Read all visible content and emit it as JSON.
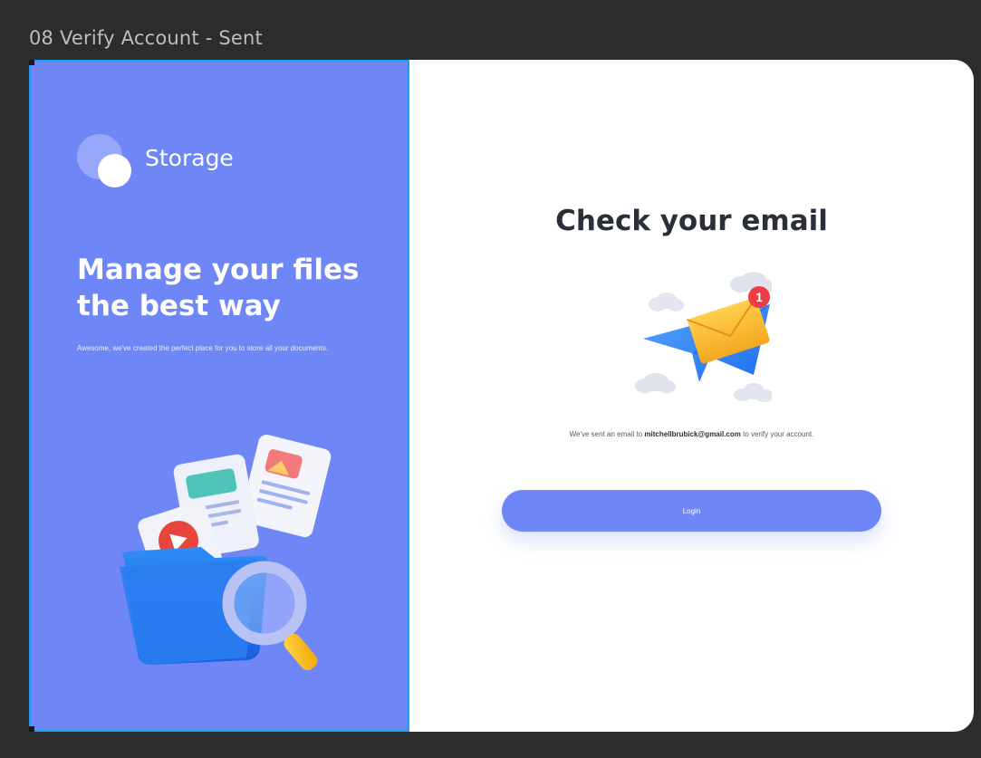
{
  "frame": {
    "title": "08 Verify Account - Sent"
  },
  "brand": {
    "name": "Storage"
  },
  "left_panel": {
    "headline": "Manage your files the best way",
    "tagline": "Awesome, we've created the perfect place for you to store all your documents."
  },
  "main": {
    "title": "Check your email",
    "message_prefix": "We've sent an email to",
    "email": "mitchellbrubick@gmail.com",
    "message_suffix": "to verify your account.",
    "notification_count": "1",
    "login_label": "Login"
  },
  "colors": {
    "accent": "#6f86f7",
    "background": "#2c2c2c",
    "selection": "#18a0fb",
    "title_text": "#2b2f3a"
  },
  "icons": {
    "logo": "storage-logo-icon",
    "left_illustration": "folder-with-files-and-magnifier-icon",
    "mail_illustration": "paper-plane-envelope-icon"
  }
}
